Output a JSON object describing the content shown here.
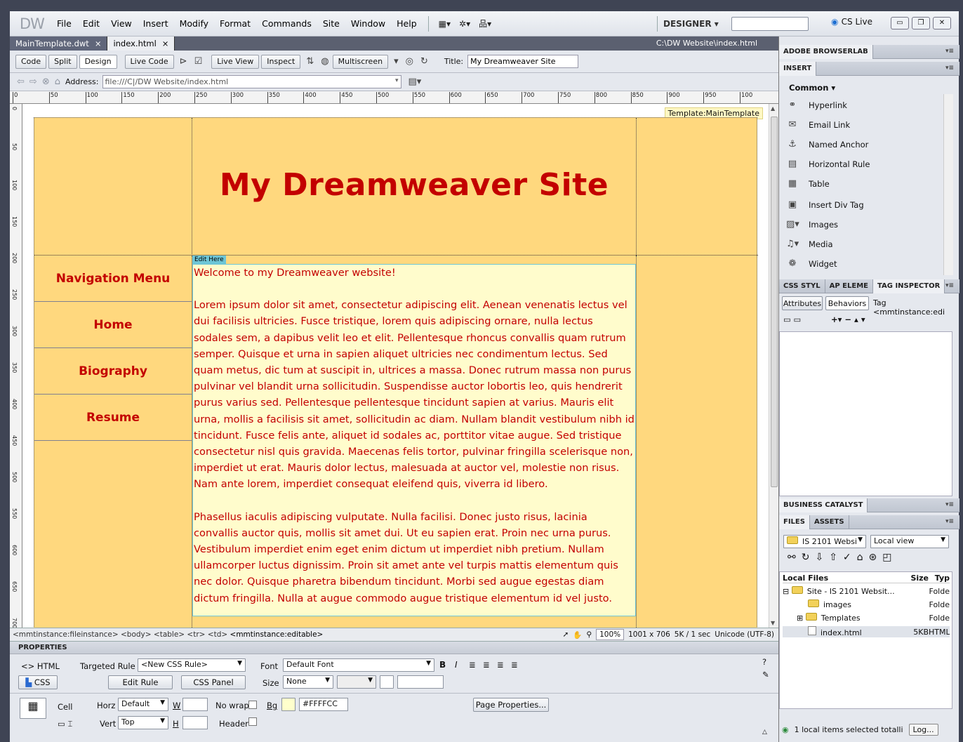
{
  "app": {
    "logo": "DW"
  },
  "menu": {
    "items": [
      "File",
      "Edit",
      "View",
      "Insert",
      "Modify",
      "Format",
      "Commands",
      "Site",
      "Window",
      "Help"
    ]
  },
  "workspace": {
    "label": "DESIGNER ▾"
  },
  "cslive": {
    "label": "CS Live"
  },
  "doc_tabs": [
    {
      "label": "MainTemplate.dwt",
      "close": "×"
    },
    {
      "label": "index.html",
      "close": "×"
    }
  ],
  "doc_path": "C:\\DW Website\\index.html",
  "doc_toolbar": {
    "code": "Code",
    "split": "Split",
    "design": "Design",
    "live_code": "Live Code",
    "live_view": "Live View",
    "inspect": "Inspect",
    "multiscreen": "Multiscreen",
    "title_label": "Title:",
    "title_value": "My Dreamweaver Site"
  },
  "address": {
    "label": "Address:",
    "value": "file:///C|/DW Website/index.html"
  },
  "ruler_marks": [
    "0",
    "50",
    "100",
    "150",
    "200",
    "250",
    "300",
    "350",
    "400",
    "450",
    "500",
    "550",
    "600",
    "650",
    "700",
    "750",
    "800",
    "850",
    "900",
    "950",
    "100"
  ],
  "vruler_marks": [
    "0",
    "50",
    "100",
    "150",
    "200",
    "250",
    "300",
    "350",
    "400",
    "450",
    "500",
    "550",
    "600",
    "650",
    "700"
  ],
  "canvas": {
    "template_label": "Template:MainTemplate",
    "site_title": "My Dreamweaver Site",
    "nav_items": [
      "Navigation Menu",
      "Home",
      "Biography",
      "Resume"
    ],
    "edit_here": "Edit Here",
    "welcome": "Welcome to my Dreamweaver website!",
    "para1": "Lorem ipsum dolor sit amet, consectetur adipiscing elit. Aenean venenatis lectus vel dui facilisis ultricies. Fusce tristique, lorem quis adipiscing ornare, nulla lectus sodales sem, a dapibus velit leo et elit. Pellentesque rhoncus convallis quam rutrum semper. Quisque et urna in sapien aliquet ultricies nec condimentum lectus. Sed quam metus, dic tum at suscipit in, ultrices a massa. Donec rutrum massa non purus pulvinar vel blandit urna sollicitudin. Suspendisse auctor lobortis leo, quis hendrerit purus varius sed. Pellentesque pellentesque tincidunt sapien at varius. Mauris elit urna, mollis a facilisis sit amet, sollicitudin ac diam. Nullam blandit vestibulum nibh id tincidunt. Fusce felis ante, aliquet id sodales ac, porttitor vitae augue. Sed tristique consectetur nisl quis gravida. Maecenas felis tortor, pulvinar fringilla scelerisque non, imperdiet ut erat. Mauris dolor lectus, malesuada at auctor vel, molestie non risus. Nam ante lorem, imperdiet consequat eleifend quis, viverra id libero.",
    "para2": "Phasellus iaculis adipiscing vulputate. Nulla facilisi. Donec justo risus, lacinia convallis auctor quis, mollis sit amet dui. Ut eu sapien erat. Proin nec urna purus. Vestibulum imperdiet enim eget enim dictum ut imperdiet nibh pretium. Nullam ullamcorper luctus dignissim. Proin sit amet ante vel turpis mattis elementum quis nec dolor. Quisque pharetra bibendum tincidunt. Morbi sed augue egestas diam dictum fringilla. Nulla at augue commodo augue tristique elementum id vel justo."
  },
  "status": {
    "tag_path": "<mmtinstance:fileinstance> <body> <table> <tr> <td>",
    "tag_current": "<mmtinstance:editable>",
    "zoom": "100%",
    "dims": "1001 x 706",
    "size": "5K / 1 sec",
    "encoding": "Unicode (UTF-8)"
  },
  "properties": {
    "header": "PROPERTIES",
    "html_btn": "<> HTML",
    "css_btn": "CSS",
    "targeted_rule_label": "Targeted Rule",
    "targeted_rule_value": "<New CSS Rule>",
    "edit_rule": "Edit Rule",
    "css_panel": "CSS Panel",
    "font_label": "Font",
    "font_value": "Default Font",
    "size_label": "Size",
    "size_value": "None",
    "cell_label": "Cell",
    "horz_label": "Horz",
    "horz_value": "Default",
    "vert_label": "Vert",
    "vert_value": "Top",
    "w_label": "W",
    "h_label": "H",
    "nowrap_label": "No wrap",
    "header_label": "Header",
    "bg_label": "Bg",
    "bg_value": "#FFFFCC",
    "page_properties": "Page Properties..."
  },
  "panels": {
    "browserlab": "ADOBE BROWSERLAB",
    "insert": "INSERT",
    "insert_category": "Common ▾",
    "insert_items": [
      "Hyperlink",
      "Email Link",
      "Named Anchor",
      "Horizontal Rule",
      "Table",
      "Insert Div Tag",
      "Images",
      "Media",
      "Widget"
    ],
    "css_tabs": [
      "CSS STYL",
      "AP ELEME",
      "TAG INSPECTOR"
    ],
    "tag_subtabs": [
      "Attributes",
      "Behaviors"
    ],
    "tag_label": "Tag <mmtinstance:edi",
    "business_catalyst": "BUSINESS CATALYST",
    "files_tabs": [
      "FILES",
      "ASSETS"
    ],
    "site_select": "IS 2101 Websi",
    "view_select": "Local view",
    "files_header": {
      "name": "Local Files",
      "size": "Size",
      "type": "Typ"
    },
    "files": [
      {
        "name": "Site - IS 2101 Websit...",
        "size": "",
        "type": "Folde"
      },
      {
        "name": "images",
        "size": "",
        "type": "Folde"
      },
      {
        "name": "Templates",
        "size": "",
        "type": "Folde"
      },
      {
        "name": "index.html",
        "size": "5KB",
        "type": "HTML"
      }
    ],
    "status_text": "1 local items selected totalli",
    "log_btn": "Log..."
  }
}
